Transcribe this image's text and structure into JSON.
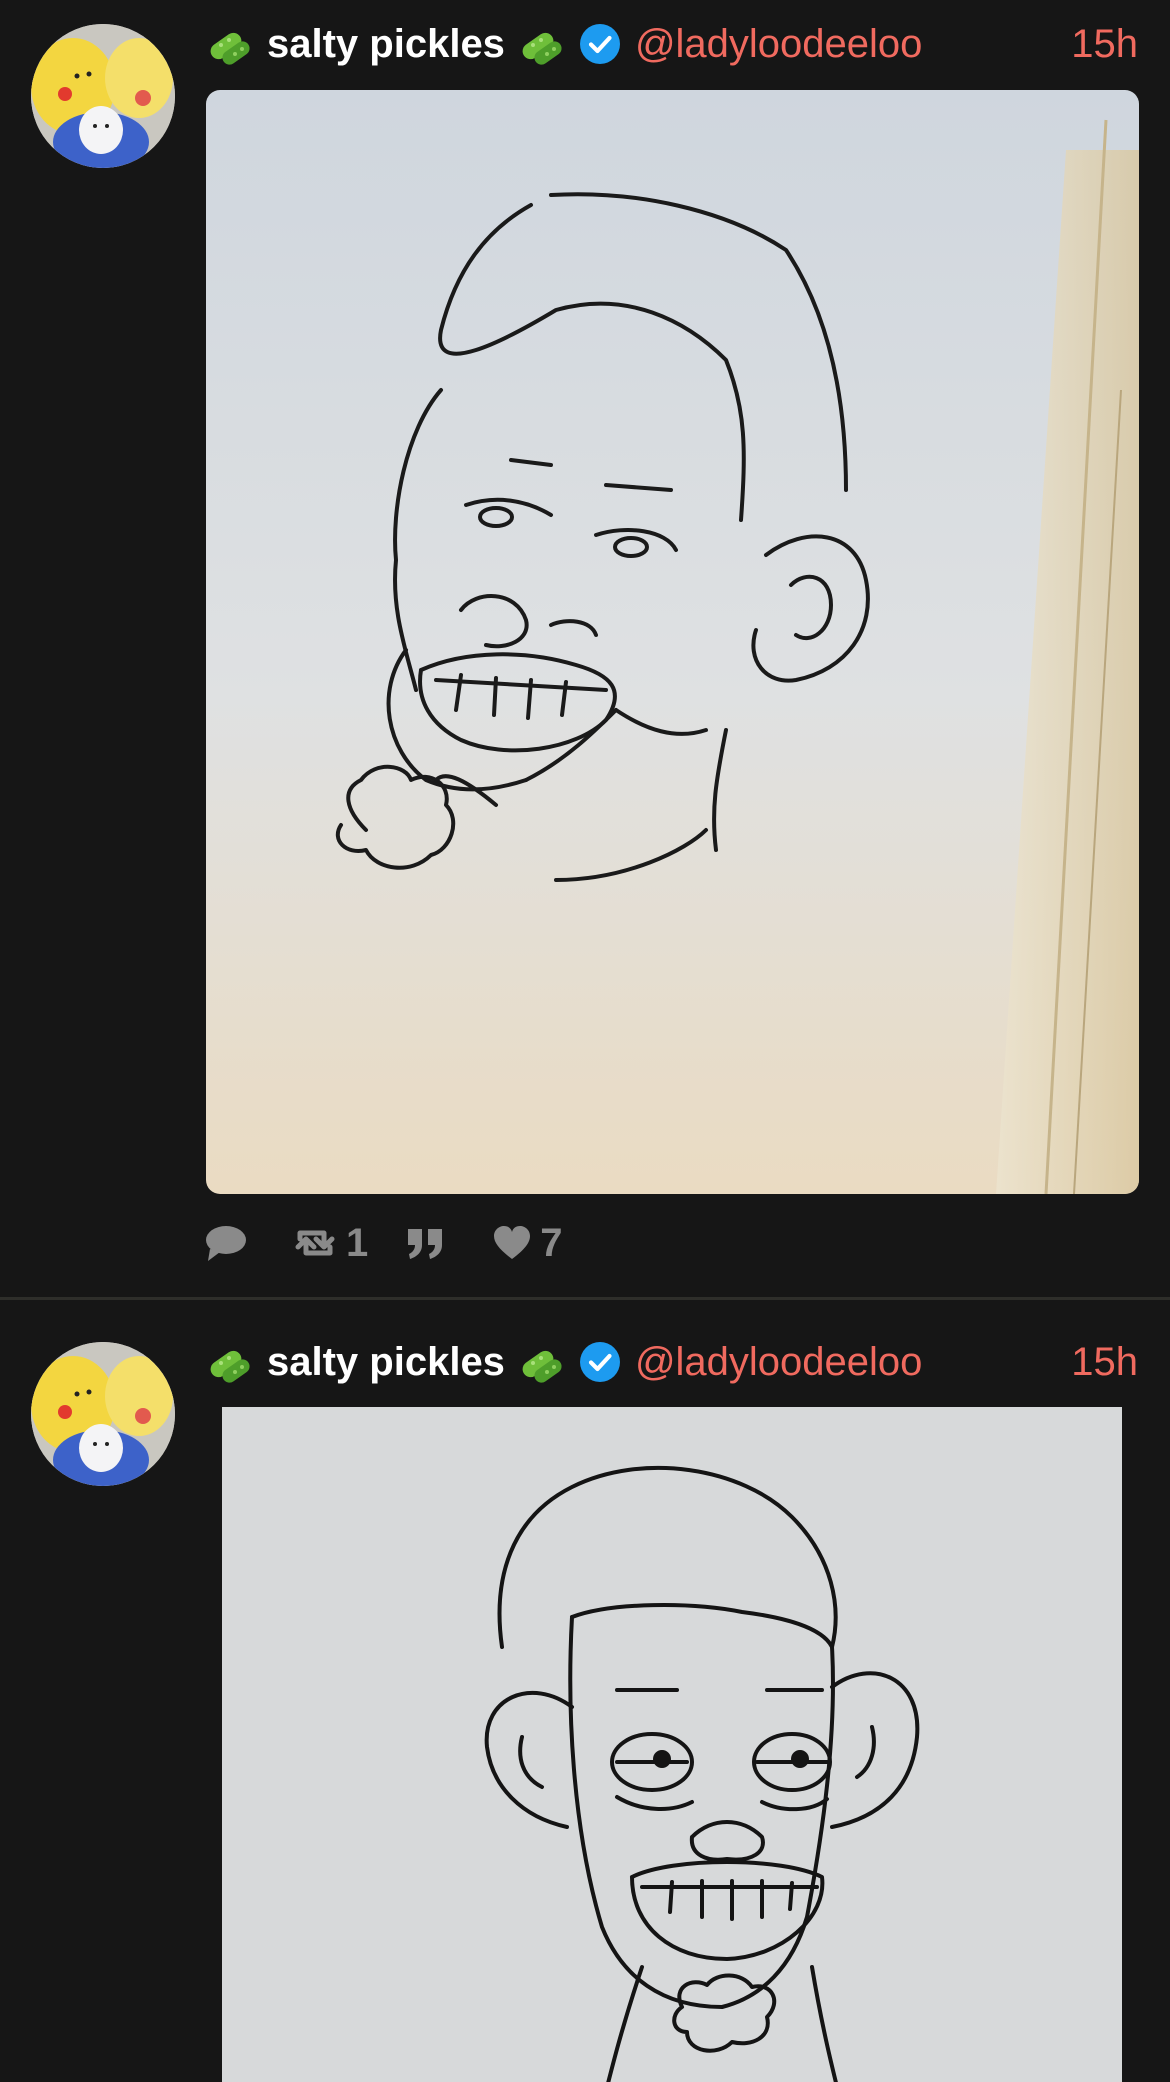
{
  "posts": [
    {
      "display_name": "salty pickles",
      "handle": "@ladyloodeeloo",
      "time": "15h",
      "actions": {
        "reply_count": "",
        "boost_count": "1",
        "quote_count": "",
        "like_count": "7"
      },
      "media_icon": "caricature-drawing-profile"
    },
    {
      "display_name": "salty pickles",
      "handle": "@ladyloodeeloo",
      "time": "15h",
      "media_icon": "caricature-drawing-front"
    }
  ],
  "colors": {
    "background": "#161616",
    "accent": "#f06a5f",
    "verified": "#1d9bf0",
    "muted": "#8a8a8a"
  },
  "icons": [
    "pickle-emoji",
    "verified-badge-icon",
    "reply-icon",
    "boost-icon",
    "quote-icon",
    "heart-icon"
  ]
}
